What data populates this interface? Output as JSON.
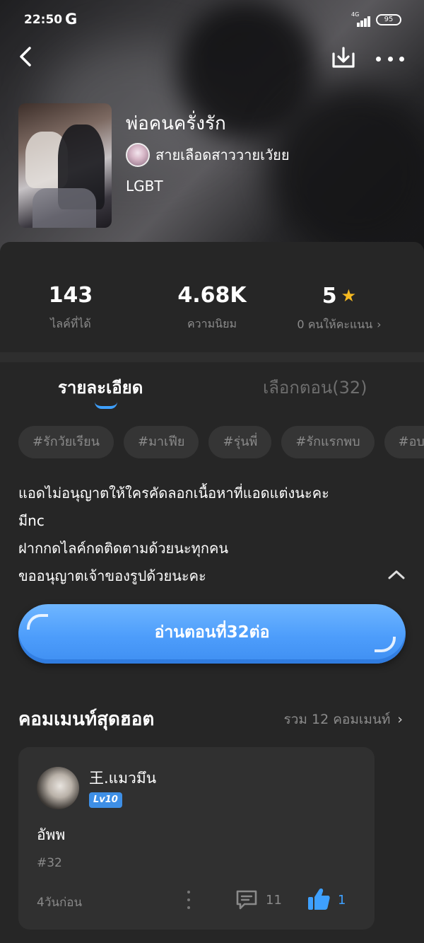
{
  "status_bar": {
    "time": "22:50",
    "carrier_icon": "G",
    "network": "4G",
    "battery": "95"
  },
  "story": {
    "title": "พ่อคนครั่งรัก",
    "author": "สายเลือดสาววายเวัยย",
    "genre": "LGBT"
  },
  "stats": {
    "likes_value": "143",
    "likes_label": "ไลค์ที่ได้",
    "popularity_value": "4.68K",
    "popularity_label": "ความนิยม",
    "rating_value": "5",
    "rating_label": "0 คนให้คะแนน"
  },
  "tabs": {
    "details": "รายละเอียด",
    "chapters": "เลือกตอน(32)"
  },
  "tags": [
    "#รักวัยเรียน",
    "#มาเฟีย",
    "#รุ่นพี่",
    "#รักแรกพบ",
    "#อบ"
  ],
  "description": [
    "แอดไม่อนุญาตให้ใครคัดลอกเนื้อหาที่แอดแต่งนะคะ",
    "มีnc",
    "ฝากกดไลค์กดติดตามด้วยนะทุกคน",
    "ขออนุญาตเจ้าของรูปด้วยนะคะ"
  ],
  "read_button": "อ่านตอนที่32ต่อ",
  "comments": {
    "section_title": "คอมเมนท์สุดฮอต",
    "total": "รวม 12 คอมเมนท์",
    "items": [
      {
        "user": "王.แมวมึน",
        "level": "Lv10",
        "text": "อัพพ",
        "chapter": "#32",
        "time": "4วันก่อน",
        "replies": "11",
        "likes": "1"
      }
    ]
  },
  "colors": {
    "accent": "#3ea0ff",
    "background": "#262626",
    "star": "#f5b921"
  }
}
